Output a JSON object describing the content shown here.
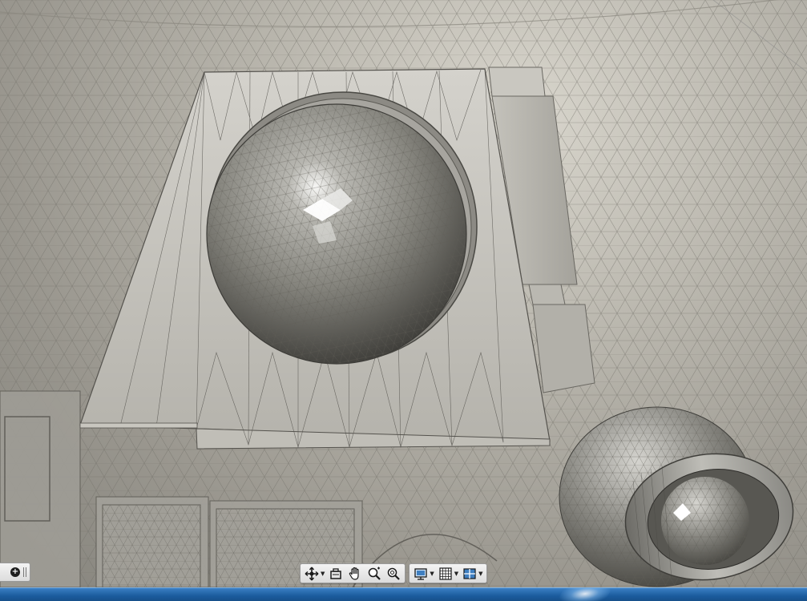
{
  "scene": {
    "description_icon": "3d-viewport-mesh",
    "background_color": "#b9b6ad",
    "mesh_line_color": "#6f6d66",
    "sphere_highlight_color": "#ffffff"
  },
  "left_control": {
    "icon": "plus-circle-icon",
    "label": "+"
  },
  "nav_toolbar": {
    "tools": [
      {
        "icon": "pan-orbit-icon",
        "has_dropdown": true
      },
      {
        "icon": "look-at-icon",
        "has_dropdown": false
      },
      {
        "icon": "hand-pan-icon",
        "has_dropdown": false
      },
      {
        "icon": "zoom-window-icon",
        "has_dropdown": false
      },
      {
        "icon": "zoom-icon",
        "has_dropdown": false
      }
    ],
    "display": [
      {
        "icon": "display-settings-icon",
        "has_dropdown": true
      },
      {
        "icon": "grid-icon",
        "has_dropdown": true
      },
      {
        "icon": "viewports-icon",
        "has_dropdown": true
      }
    ]
  },
  "taskbar": {
    "accent": "#1b5c9e"
  }
}
